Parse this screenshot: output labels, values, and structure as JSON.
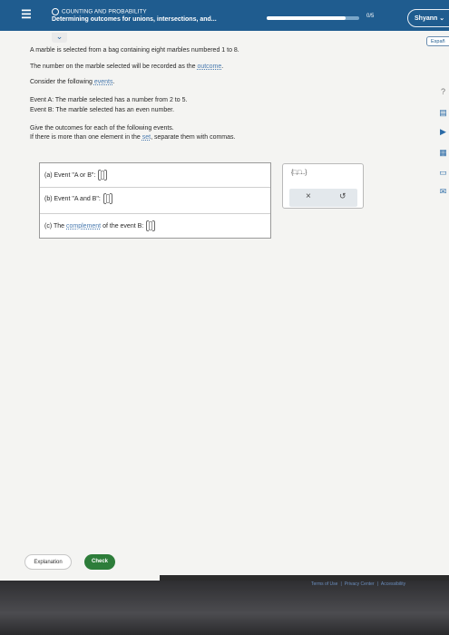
{
  "header": {
    "topic": "COUNTING AND PROBABILITY",
    "subtitle": "Determining outcomes for unions, intersections, and...",
    "progress_text": "0/5",
    "progress_fraction": 0.85,
    "user_name": "Shyann",
    "language_button": "Españ"
  },
  "problem": {
    "line1": "A marble is selected from a bag containing eight marbles numbered 1 to 8.",
    "line2_pre": "The number on the marble selected will be recorded as the ",
    "line2_link": "outcome",
    "line2_post": ".",
    "line3_pre": "Consider the following ",
    "line3_link": "events",
    "line3_post": ".",
    "eventA": "Event A: The marble selected has a number from 2 to 5.",
    "eventB": "Event B: The marble selected has an even number.",
    "instr1": "Give the outcomes for each of the following events.",
    "instr2_pre": "If there is more than one element in the ",
    "instr2_link": "set",
    "instr2_post": ", separate them with commas."
  },
  "answers": {
    "a_label": "(a) Event \"A or B\":",
    "b_label": "(b) Event \"A and B\":",
    "c_pre": "(c) The ",
    "c_link": "complement",
    "c_post": " of the event B:"
  },
  "tools": {
    "set_icon": "{□,□...}",
    "clear": "×",
    "undo": "↺"
  },
  "side": {
    "help": "?",
    "book": "▤",
    "video": "▶",
    "calc": "▦",
    "doc": "▭",
    "mail": "✉"
  },
  "buttons": {
    "explanation": "Explanation",
    "check": "Check"
  },
  "footer": {
    "terms": "Terms of Use",
    "privacy": "Privacy Center",
    "access": "Accessibility"
  },
  "colors": {
    "header": "#1f5c8f",
    "check": "#2d7d3a"
  }
}
